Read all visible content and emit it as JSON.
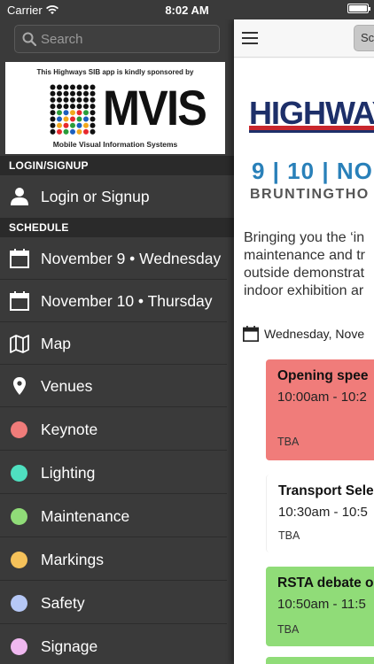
{
  "status": {
    "carrier": "Carrier",
    "time": "8:02 AM"
  },
  "search": {
    "placeholder": "Search"
  },
  "sponsor": {
    "top_text": "This Highways SIB app is kindly sponsored by",
    "logo": "MVIS",
    "sub_text": "Mobile Visual Information Systems"
  },
  "sections": {
    "login": "LOGIN/SIGNUP",
    "schedule": "SCHEDULE"
  },
  "menu": {
    "login": "Login or Signup",
    "day1": "November 9 • Wednesday",
    "day2": "November 10 • Thursday",
    "map": "Map",
    "venues": "Venues",
    "keynote": "Keynote",
    "lighting": "Lighting",
    "maintenance": "Maintenance",
    "markings": "Markings",
    "safety": "Safety",
    "signage": "Signage"
  },
  "colors": {
    "keynote": "#f07c7a",
    "lighting": "#4fe0c0",
    "maintenance": "#90dc78",
    "markings": "#f6c25a",
    "safety": "#b6c8f6",
    "signage": "#f0b8f0"
  },
  "main": {
    "toolbar_button": "Sc",
    "banner": "HIGHWAYS",
    "dates": "9 | 10 | NO",
    "venue": "BRUNTINGTHO",
    "intro_lines": [
      "Bringing you the ‘in",
      "maintenance and tr",
      "outside demonstrat",
      "indoor exhibition ar"
    ],
    "day_label": "Wednesday, Nove",
    "events": [
      {
        "title": "Opening spee",
        "time": "10:00am - 10:2",
        "location": "TBA",
        "color": "#f07c7a"
      },
      {
        "title": "Transport Sele",
        "time": "10:30am - 10:5",
        "location": "TBA",
        "color": "#ffffff"
      },
      {
        "title": "RSTA debate o",
        "time": "10:50am - 11:5",
        "location": "TBA",
        "color": "#90dc78"
      }
    ]
  }
}
